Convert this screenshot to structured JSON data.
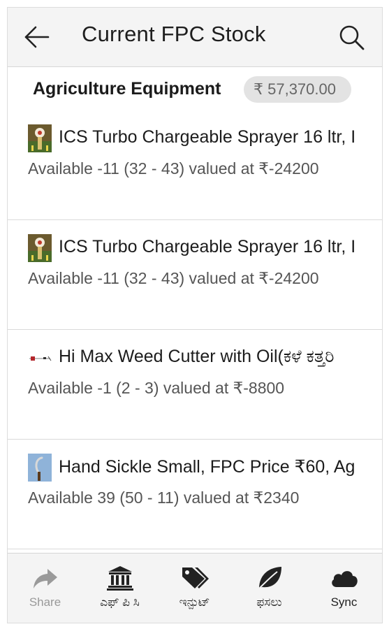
{
  "header": {
    "title": "Current FPC Stock"
  },
  "category": {
    "title": "Agriculture Equipment",
    "total": "₹ 57,370.00"
  },
  "items": [
    {
      "name": "ICS Turbo Chargeable Sprayer 16 ltr, I",
      "availability": "Available -11 (32 - 43) valued at ₹-24200",
      "icon": "sprayer-thumbnail"
    },
    {
      "name": "ICS Turbo Chargeable Sprayer 16 ltr, I",
      "availability": "Available -11 (32 - 43) valued at ₹-24200",
      "icon": "sprayer-thumbnail"
    },
    {
      "name": "Hi Max Weed Cutter with Oil(ಕಳೆ ಕತ್ತರಿ",
      "availability": "Available -1 (2 - 3) valued at ₹-8800",
      "icon": "weed-cutter-thumbnail"
    },
    {
      "name": "Hand Sickle Small, FPC Price ₹60, Ag",
      "availability": "Available 39 (50 - 11) valued at ₹2340",
      "icon": "sickle-thumbnail"
    }
  ],
  "bottom_nav": {
    "share": "Share",
    "fpc": "ಎಫ್ ಪಿ ಸಿ",
    "input": "ಇನ್ಪುಟ್",
    "crops": "ಫಸಲು",
    "sync": "Sync"
  },
  "colors": {
    "appbar_bg": "#f4f4f4",
    "badge_bg": "#e3e3e3",
    "divider": "#dadada",
    "text_primary": "#1c1c1c",
    "text_secondary": "#555555",
    "share_disabled": "#999999"
  }
}
